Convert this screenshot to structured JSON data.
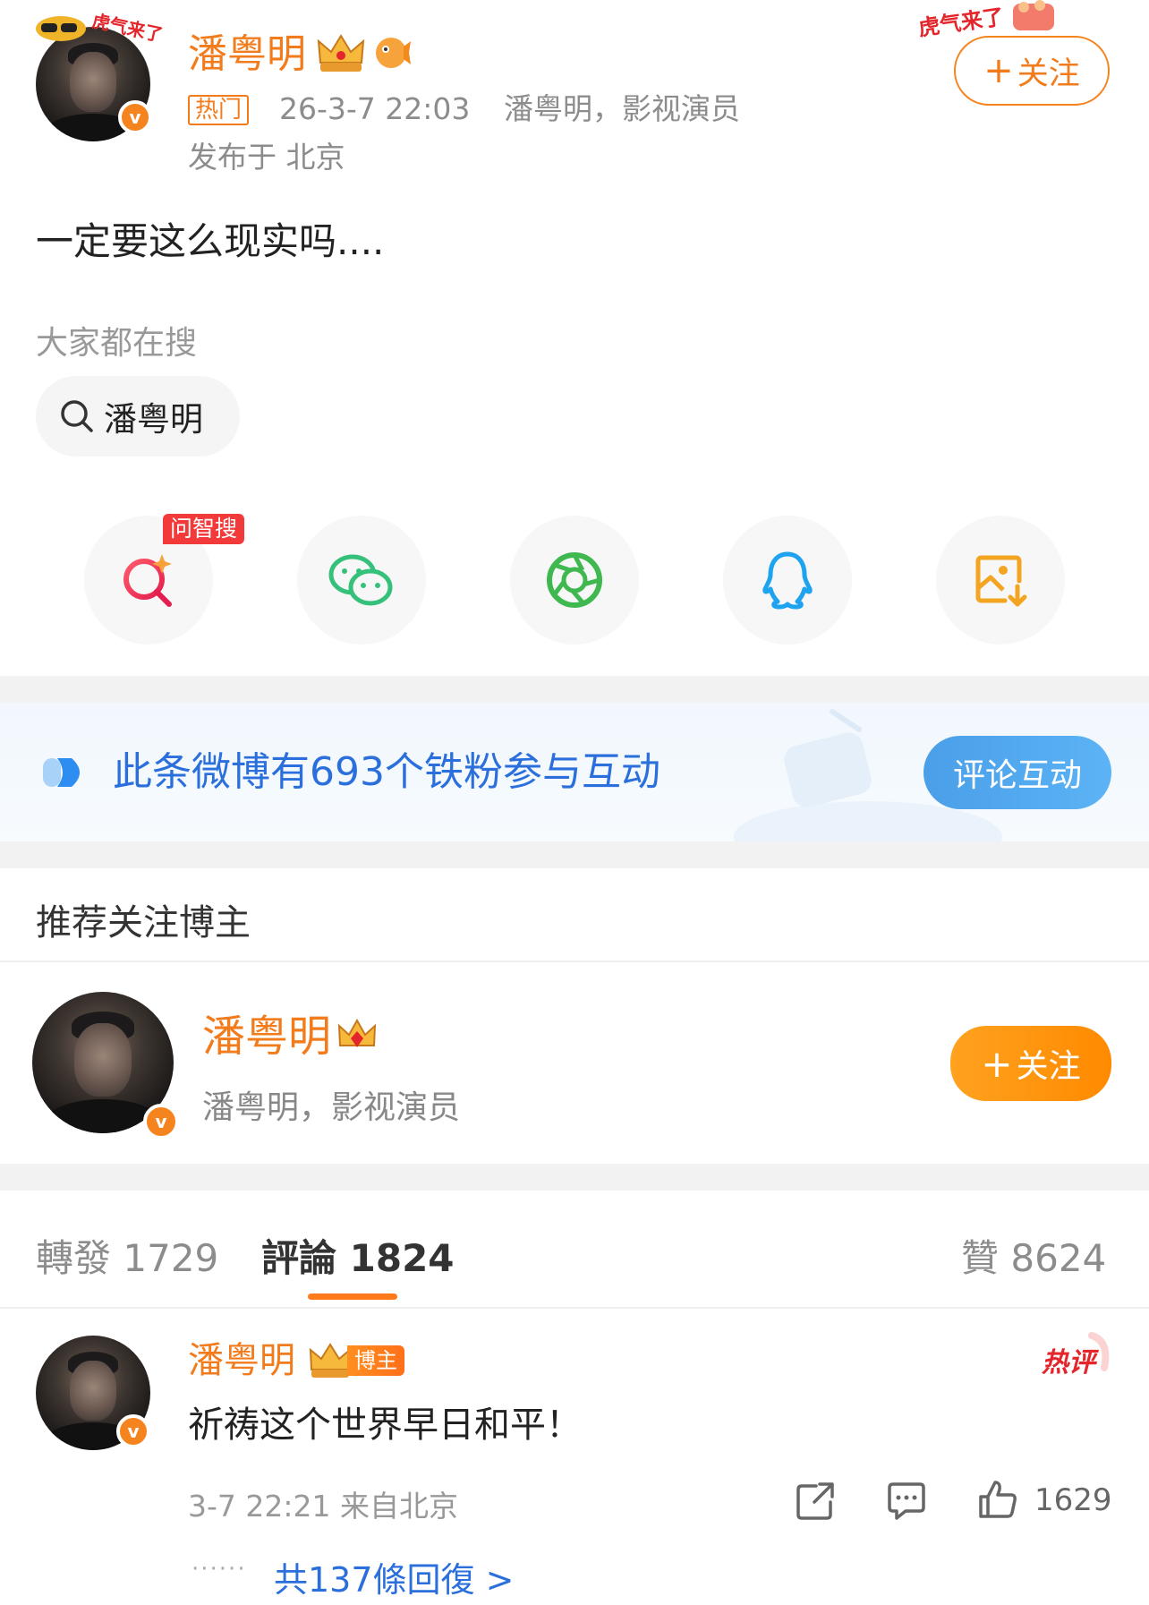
{
  "post": {
    "author_name": "潘粤明",
    "hot_tag": "热门",
    "timestamp": "26-3-7 22:03",
    "author_desc": "潘粤明，影视演员",
    "location": "发布于 北京",
    "content": "一定要这么现实吗....",
    "follow_label": "关注",
    "avatar_sticker": "虎气来了",
    "corner_sticker": "虎气来了"
  },
  "trending": {
    "heading": "大家都在搜",
    "chip_label": "潘粤明"
  },
  "share": {
    "ai_badge": "问智搜",
    "items": [
      "ai-search-icon",
      "wechat-icon",
      "moments-icon",
      "qq-icon",
      "save-image-icon"
    ]
  },
  "fans_banner": {
    "text": "此条微博有693个铁粉参与互动",
    "button": "评论互动"
  },
  "recommend": {
    "heading": "推荐关注博主",
    "name": "潘粤明",
    "desc": "潘粤明，影视演员",
    "follow_label": "关注"
  },
  "tabs": {
    "repost_label": "轉發",
    "repost_count": "1729",
    "comment_label": "評論",
    "comment_count": "1824",
    "like_label": "贊",
    "like_count": "8624"
  },
  "comment": {
    "name": "潘粤明",
    "author_badge": "博主",
    "hot_badge": "热评",
    "text": "祈祷这个世界早日和平！",
    "meta": "3-7 22:21 来自北京",
    "like_count": "1629",
    "dots": "······",
    "replies": "共137條回復 >"
  },
  "colors": {
    "brand_orange": "#f27b1c",
    "link_blue": "#2a6fdb",
    "banner_blue": "#4a9fe8"
  }
}
